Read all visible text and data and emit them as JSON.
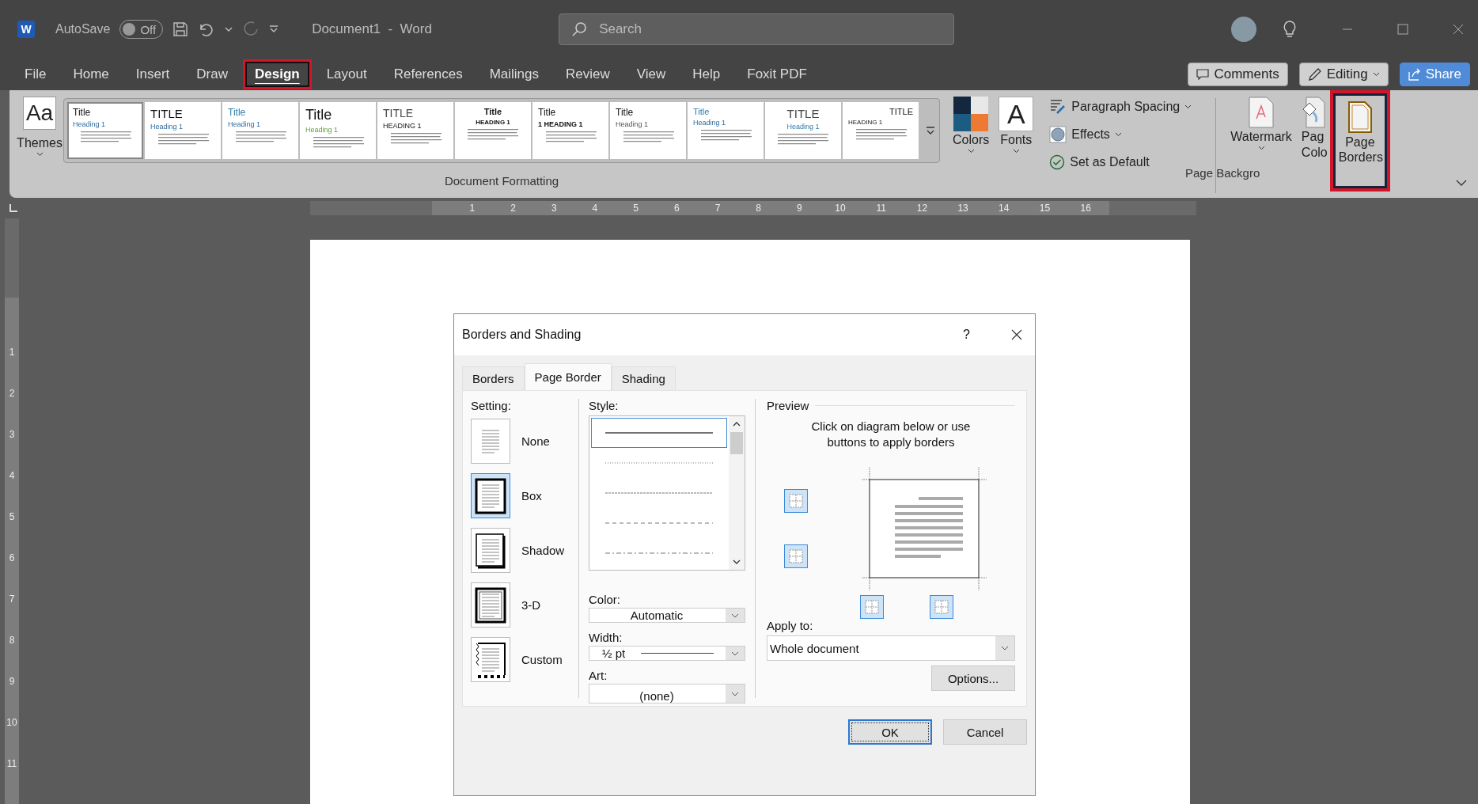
{
  "title_bar": {
    "app_badge": "W",
    "autosave_label": "AutoSave",
    "autosave": {
      "on": false,
      "label": "Off"
    },
    "document_title": "Document1  -  Word",
    "search": {
      "placeholder": "Search"
    }
  },
  "menu": {
    "tabs": [
      {
        "label": "File",
        "selected": false,
        "highlighted": false
      },
      {
        "label": "Home",
        "selected": false,
        "highlighted": false
      },
      {
        "label": "Insert",
        "selected": false,
        "highlighted": false
      },
      {
        "label": "Draw",
        "selected": false,
        "highlighted": false
      },
      {
        "label": "Design",
        "selected": true,
        "highlighted": true
      },
      {
        "label": "Layout",
        "selected": false,
        "highlighted": false
      },
      {
        "label": "References",
        "selected": false,
        "highlighted": false
      },
      {
        "label": "Mailings",
        "selected": false,
        "highlighted": false
      },
      {
        "label": "Review",
        "selected": false,
        "highlighted": false
      },
      {
        "label": "View",
        "selected": false,
        "highlighted": false
      },
      {
        "label": "Help",
        "selected": false,
        "highlighted": false
      },
      {
        "label": "Foxit PDF",
        "selected": false,
        "highlighted": false
      }
    ],
    "comments": "Comments",
    "editing": "Editing",
    "share": "Share"
  },
  "ribbon": {
    "themes": "Themes",
    "themes_icon_text": "Aa",
    "style_gallery": [
      {
        "title": "Title",
        "heading": "Heading 1",
        "kind": "basic",
        "selected": true
      },
      {
        "title": "TITLE",
        "heading": "Heading 1",
        "kind": "caps",
        "selected": false
      },
      {
        "title": "Title",
        "heading": "Heading 1",
        "kind": "blue",
        "selected": false
      },
      {
        "title": "Title",
        "heading": "Heading 1",
        "kind": "large",
        "selected": false
      },
      {
        "title": "TITLE",
        "heading": "HEADING 1",
        "kind": "caps-heading",
        "selected": false
      },
      {
        "title": "Title",
        "heading": "HEADING 1",
        "kind": "bold-center",
        "selected": false
      },
      {
        "title": "Title",
        "heading": "1  HEADING 1",
        "kind": "numbered",
        "selected": false
      },
      {
        "title": "Title",
        "heading": "Heading 1",
        "kind": "plain",
        "selected": false
      },
      {
        "title": "Title",
        "heading": "Heading 1",
        "kind": "blue-small",
        "selected": false
      },
      {
        "title": "TITLE",
        "heading": "Heading 1",
        "kind": "centered",
        "selected": false
      },
      {
        "title": "TITLE",
        "heading": "HEADING 1",
        "kind": "right",
        "selected": false
      }
    ],
    "colors": "Colors",
    "fonts": "Fonts",
    "font_sample": "A",
    "paragraph_spacing": "Paragraph Spacing",
    "effects": "Effects",
    "set_as_default": "Set as Default",
    "watermark": "Watermark",
    "page_color": [
      "Pag",
      "Colo"
    ],
    "page_borders": {
      "label": "Page Borders",
      "highlighted": true
    },
    "document_formatting": "Document Formatting",
    "page_background": "Page Backgro"
  },
  "ruler": {
    "horizontal": [
      "1",
      "2",
      "3",
      "4",
      "5",
      "6",
      "7",
      "8",
      "9",
      "10",
      "11",
      "12",
      "13",
      "14",
      "15",
      "16"
    ],
    "vertical": [
      "1",
      "2",
      "3",
      "4",
      "5",
      "6",
      "7",
      "8",
      "9",
      "10",
      "11"
    ]
  },
  "dialog": {
    "title": "Borders and Shading",
    "help": "?",
    "tabs": [
      {
        "label": "Borders",
        "selected": false
      },
      {
        "label": "Page Border",
        "selected": true
      },
      {
        "label": "Shading",
        "selected": false
      }
    ],
    "setting_label": "Setting:",
    "settings": [
      {
        "label": "None",
        "kind": "none",
        "selected": false
      },
      {
        "label": "Box",
        "kind": "box",
        "selected": true
      },
      {
        "label": "Shadow",
        "kind": "shadow",
        "selected": false
      },
      {
        "label": "3-D",
        "kind": "threed",
        "selected": false
      },
      {
        "label": "Custom",
        "kind": "custom",
        "selected": false
      }
    ],
    "style_label": "Style:",
    "styles": [
      {
        "kind": "solid",
        "selected": true
      },
      {
        "kind": "dotted",
        "selected": false
      },
      {
        "kind": "fine-dash",
        "selected": false
      },
      {
        "kind": "dashed",
        "selected": false
      },
      {
        "kind": "dash-dot",
        "selected": false
      }
    ],
    "color_label": "Color:",
    "color_value": "Automatic",
    "width_label": "Width:",
    "width": "½ pt",
    "art_label": "Art:",
    "art": "(none)",
    "preview_label": "Preview",
    "preview_hint": "Click on diagram below or use buttons to apply borders",
    "apply_label": "Apply to:",
    "apply_to": "Whole document",
    "options": "Options...",
    "ok": "OK",
    "cancel": "Cancel"
  }
}
